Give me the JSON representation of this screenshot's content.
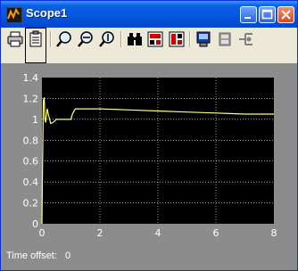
{
  "window": {
    "title": "Scope1",
    "buttons": [
      "minimize",
      "maximize",
      "close"
    ]
  },
  "toolbar": {
    "items": [
      {
        "name": "print",
        "icon": "printer-icon"
      },
      {
        "name": "parameters",
        "icon": "parameters-icon",
        "pressed": true
      },
      {
        "name": "zoom",
        "icon": "zoom-icon"
      },
      {
        "name": "zoom-x-axis",
        "icon": "zoom-x-icon"
      },
      {
        "name": "zoom-y-axis",
        "icon": "zoom-y-icon"
      },
      {
        "name": "autoscale",
        "icon": "binoculars-icon"
      },
      {
        "name": "save-axes-settings",
        "icon": "save-axes-icon"
      },
      {
        "name": "restore-axes-settings",
        "icon": "restore-axes-icon"
      },
      {
        "name": "floating-scope",
        "icon": "floating-scope-icon"
      },
      {
        "name": "lock-axes",
        "icon": "lock-axes-icon"
      },
      {
        "name": "signal-selection",
        "icon": "signal-selection-icon"
      }
    ]
  },
  "status": {
    "time_offset_label": "Time offset:",
    "time_offset_value": "0"
  },
  "colors": {
    "plot_background": "#000000",
    "figure_background": "#8c8c8c",
    "signal": "#ffff80",
    "grid": "#ffffff",
    "titlebar": "#0555dd"
  },
  "chart_data": {
    "type": "line",
    "title": "",
    "xlabel": "",
    "ylabel": "",
    "xlim": [
      0,
      8
    ],
    "ylim": [
      0,
      1.4
    ],
    "xticks": [
      "0",
      "2",
      "4",
      "6",
      "8"
    ],
    "yticks": [
      "0",
      "0.2",
      "0.4",
      "0.6",
      "0.8",
      "1",
      "1.2",
      "1.4"
    ],
    "grid": true,
    "series": [
      {
        "x": [
          0,
          0.02,
          0.05,
          0.08,
          0.1,
          0.13,
          0.18,
          0.22,
          0.3,
          0.38,
          0.5,
          0.6,
          0.75,
          0.9,
          1.0,
          1.05,
          1.15,
          1.3,
          1.6,
          2.0,
          3.0,
          4.0,
          5.0,
          6.0,
          7.0,
          8.0
        ],
        "y": [
          0,
          0.5,
          1.18,
          1.21,
          1.0,
          0.97,
          1.1,
          1.05,
          0.96,
          0.97,
          1.0,
          1.0,
          1.0,
          1.0,
          1.0,
          1.05,
          1.1,
          1.1,
          1.1,
          1.1,
          1.09,
          1.08,
          1.07,
          1.06,
          1.05,
          1.05
        ]
      }
    ]
  }
}
